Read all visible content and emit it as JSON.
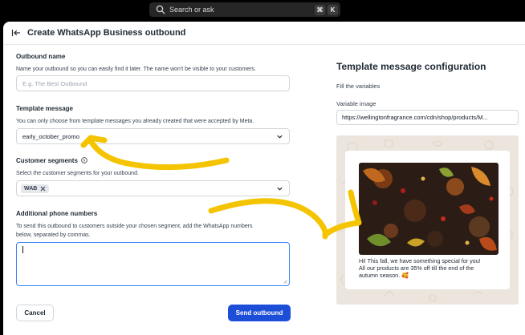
{
  "topbar": {
    "search_placeholder": "Search or ask",
    "shortcut_keys": [
      "⌘",
      "K"
    ],
    "icon": "search-icon"
  },
  "header": {
    "back_icon": "collapse-left-icon",
    "title": "Create WhatsApp Business outbound"
  },
  "form": {
    "outbound_name": {
      "label": "Outbound name",
      "help": "Name your outbound so you can easily find it later. The name won't be visible to your customers.",
      "placeholder": "E.g. The Best Outbound",
      "value": ""
    },
    "template_message": {
      "label": "Template message",
      "help": "You can only choose from template messages you already created that were accepted by Meta.",
      "selected": "early_october_promo"
    },
    "customer_segments": {
      "label": "Customer segments",
      "help": "Select the customer segments for your outbound.",
      "tags": [
        "WAB"
      ]
    },
    "additional_phone_numbers": {
      "label": "Additional phone numbers",
      "help_line1": "To send this outbound to customers outside your chosen segment, add the WhatsApp numbers",
      "help_line2": "below, separated by commas.",
      "value": ""
    }
  },
  "actions": {
    "cancel_label": "Cancel",
    "send_label": "Send outbound"
  },
  "configuration": {
    "title": "Template message configuration",
    "subtitle": "Fill the variables",
    "variable_label": "Variable image",
    "variable_value": "https://wellingtonfragrance.com/cdn/shop/products/M..."
  },
  "preview": {
    "message_line1": "Hi! This fall, we have something special for you!",
    "message_line2": "All our products are 35% off till the end of the",
    "message_line3": "autumn season. 🥰",
    "image": "autumn-leaves-spices-photo"
  },
  "colors": {
    "primary_button": "#1d4ed8",
    "annotation_arrow": "#f5c400",
    "focus_border": "#3b82f6",
    "chat_background": "#ece5dd"
  }
}
